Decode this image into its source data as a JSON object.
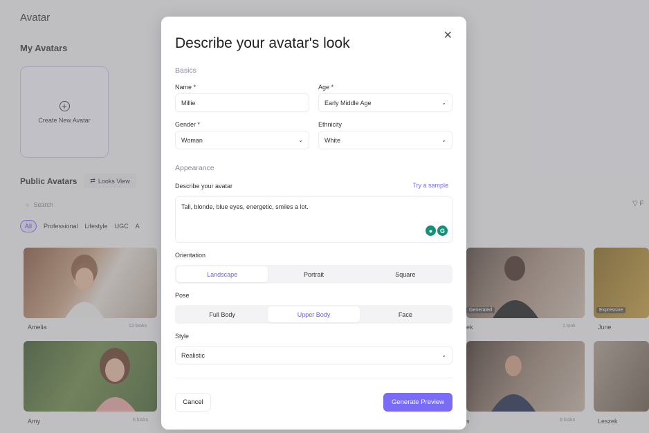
{
  "background": {
    "title": "Avatar",
    "my_avatars": "My Avatars",
    "create_new": "Create New Avatar",
    "public_avatars": "Public Avatars",
    "looks_view": "Looks View",
    "search_placeholder": "Search",
    "filter_suffix": "F",
    "chips": [
      "All",
      "Professional",
      "Lifestyle",
      "UGC",
      "A"
    ],
    "tiles": [
      {
        "name": "Amelia",
        "looks": "12 looks"
      },
      {
        "name": "Amy",
        "looks": "6 looks"
      },
      {
        "name": "ek",
        "looks": "1 look",
        "tag": "Generated"
      },
      {
        "name": "s",
        "looks": "8 looks"
      },
      {
        "name": "June",
        "tag": "Expressive"
      },
      {
        "name": "Leszek"
      }
    ]
  },
  "modal": {
    "title": "Describe your avatar's look",
    "basics": "Basics",
    "name_label": "Name *",
    "name_value": "Millie",
    "age_label": "Age *",
    "age_value": "Early Middle Age",
    "gender_label": "Gender *",
    "gender_value": "Woman",
    "ethnicity_label": "Ethnicity",
    "ethnicity_value": "White",
    "appearance": "Appearance",
    "describe_label": "Describe your avatar",
    "try_sample": "Try a sample",
    "description": "Tall, blonde, blue eyes, energetic, smiles a lot.",
    "orientation_label": "Orientation",
    "orientation_options": [
      "Landscape",
      "Portrait",
      "Square"
    ],
    "orientation_selected": "Landscape",
    "pose_label": "Pose",
    "pose_options": [
      "Full Body",
      "Upper Body",
      "Face"
    ],
    "pose_selected": "Upper Body",
    "style_label": "Style",
    "style_value": "Realistic",
    "cancel": "Cancel",
    "generate": "Generate Preview"
  },
  "colors": {
    "accent": "#7b6cf6",
    "overlay": "rgba(120,120,125,0.42)"
  }
}
